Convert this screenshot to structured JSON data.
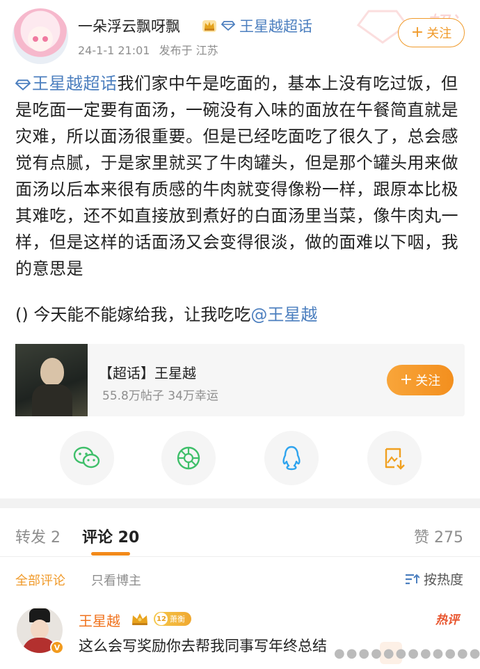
{
  "colors": {
    "accent": "#f09a2a",
    "link": "#4c7fbf",
    "hot": "#e8552e"
  },
  "header": {
    "watermark": "超话",
    "author_name": "一朵浮云飘呀飘",
    "topic_link": "王星越超话",
    "time": "24-1-1 21:01",
    "location": "发布于 江苏",
    "follow_label": "关注"
  },
  "post": {
    "inline_topic": "王星越超话",
    "text": "我们家中午是吃面的，基本上没有吃过饭，但是吃面一定要有面汤，一碗没有入味的面放在午餐简直就是灾难，所以面汤很重要。但是已经吃面吃了很久了，总会感觉有点腻，于是家里就买了牛肉罐头，但是那个罐头用来做面汤以后本来很有质感的牛肉就变得像粉一样，跟原本比极其难吃，还不如直接放到煮好的白面汤里当菜，像牛肉丸一样，但是这样的话面汤又会变得很淡，做的面难以下咽，我的意思是",
    "second_line": "() 今天能不能嫁给我，让我吃吃",
    "mention": "@王星越"
  },
  "topic_card": {
    "title": "【超话】王星越",
    "stats": "55.8万帖子 34万幸运",
    "follow_label": "关注"
  },
  "share": [
    {
      "icon": "wechat-icon"
    },
    {
      "icon": "moments-icon"
    },
    {
      "icon": "qq-icon"
    },
    {
      "icon": "save-image-icon"
    }
  ],
  "tabs": {
    "repost": "转发 2",
    "comment": "评论 20",
    "like": "赞 275"
  },
  "filters": {
    "all": "全部评论",
    "author_only": "只看博主",
    "sort": "按热度"
  },
  "comment": {
    "name": "王星越",
    "level": "12",
    "level_title": "萧衡",
    "hot_tag": "热评",
    "text": "这么会写奖励你去帮我同事写年终总结"
  }
}
